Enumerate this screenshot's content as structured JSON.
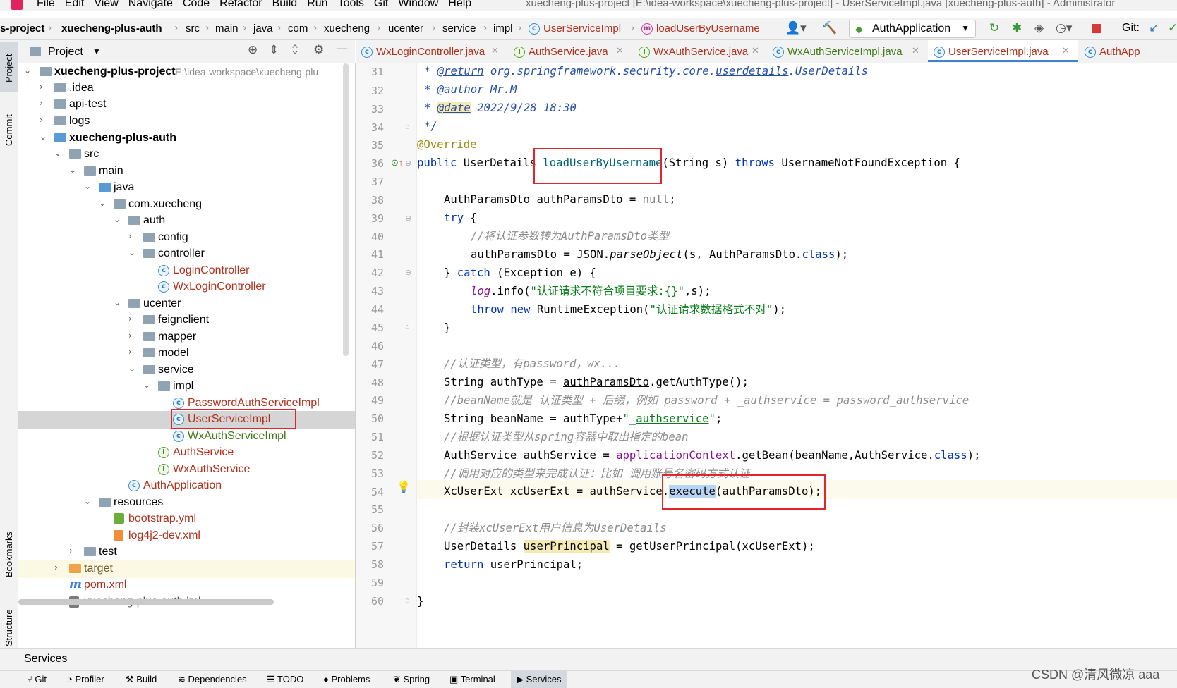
{
  "menu": {
    "items": [
      "File",
      "Edit",
      "View",
      "Navigate",
      "Code",
      "Refactor",
      "Build",
      "Run",
      "Tools",
      "Git",
      "Window",
      "Help"
    ],
    "window_title": "xuecheng-plus-project [E:\\idea-workspace\\xuecheng-plus-project] - UserServiceImpl.java [xuecheng-plus-auth] - Administrator"
  },
  "navbar": {
    "breadcrumbs": [
      "s-project",
      "xuecheng-plus-auth",
      "src",
      "main",
      "java",
      "com",
      "xuecheng",
      "ucenter",
      "service",
      "impl",
      "UserServiceImpl",
      "loadUserByUsername"
    ],
    "run_config": "AuthApplication",
    "git_label": "Git:"
  },
  "leftstrip": {
    "project": "Project",
    "commit": "Commit",
    "bookmarks": "Bookmarks",
    "structure": "Structure"
  },
  "project_panel": {
    "title": "Project",
    "tree": [
      {
        "label": "xuecheng-plus-project",
        "path": "E:\\idea-workspace\\xuecheng-plu",
        "bold": true
      },
      {
        "label": ".idea"
      },
      {
        "label": "api-test"
      },
      {
        "label": "logs"
      },
      {
        "label": "xuecheng-plus-auth",
        "bold": true
      },
      {
        "label": "src"
      },
      {
        "label": "main"
      },
      {
        "label": "java"
      },
      {
        "label": "com.xuecheng"
      },
      {
        "label": "auth"
      },
      {
        "label": "config"
      },
      {
        "label": "controller"
      },
      {
        "label": "LoginController"
      },
      {
        "label": "WxLoginController"
      },
      {
        "label": "ucenter"
      },
      {
        "label": "feignclient"
      },
      {
        "label": "mapper"
      },
      {
        "label": "model"
      },
      {
        "label": "service"
      },
      {
        "label": "impl"
      },
      {
        "label": "PasswordAuthServiceImpl"
      },
      {
        "label": "UserServiceImpl"
      },
      {
        "label": "WxAuthServiceImpl"
      },
      {
        "label": "AuthService"
      },
      {
        "label": "WxAuthService"
      },
      {
        "label": "AuthApplication"
      },
      {
        "label": "resources"
      },
      {
        "label": "bootstrap.yml"
      },
      {
        "label": "log4j2-dev.xml"
      },
      {
        "label": "test"
      },
      {
        "label": "target"
      },
      {
        "label": "pom.xml"
      },
      {
        "label": "xuecheng-plus-auth.iml"
      }
    ]
  },
  "tabs": [
    {
      "label": "WxLoginController.java",
      "icon": "class-icon"
    },
    {
      "label": "AuthService.java",
      "icon": "interface-icon"
    },
    {
      "label": "WxAuthService.java",
      "icon": "interface-icon"
    },
    {
      "label": "WxAuthServiceImpl.java",
      "icon": "class-icon"
    },
    {
      "label": "UserServiceImpl.java",
      "icon": "class-icon",
      "active": true
    },
    {
      "label": "AuthApp",
      "icon": "class-icon"
    }
  ],
  "editor": {
    "line_numbers": [
      "31",
      "32",
      "33",
      "34",
      "35",
      "36",
      "37",
      "38",
      "39",
      "40",
      "41",
      "42",
      "43",
      "44",
      "45",
      "46",
      "47",
      "48",
      "49",
      "50",
      "51",
      "52",
      "53",
      "54",
      "55",
      "56",
      "57",
      "58",
      "59",
      "60"
    ],
    "code": {
      "l31a": "* ",
      "l31b": "@return",
      "l31c": " org.springframework.security.core.",
      "l31d": "userdetails",
      "l31e": ".UserDetails",
      "l32a": "* ",
      "l32b": "@author",
      "l32c": " Mr.M",
      "l33a": "* ",
      "l33b": "@date",
      "l33c": " 2022/9/28 18:30",
      "l34": "*/",
      "l35": "@Override",
      "l36a": "public",
      "l36b": " UserDetails ",
      "l36c": "loadUserByUsername",
      "l36d": "(String s) ",
      "l36e": "throws",
      "l36f": " UsernameNotFoundException {",
      "l38a": "AuthParamsDto ",
      "l38b": "authParamsDto",
      "l38c": " = ",
      "l38d": "null",
      "l38e": ";",
      "l39a": "try",
      "l39b": " {",
      "l40": "//将认证参数转为AuthParamsDto类型",
      "l41a": "authParamsDto",
      "l41b": " = JSON.",
      "l41c": "parseObject",
      "l41d": "(s, AuthParamsDto.",
      "l41e": "class",
      "l41f": ");",
      "l42a": "} ",
      "l42b": "catch",
      "l42c": " (Exception e) {",
      "l43a": "log",
      "l43b": ".info(",
      "l43c": "\"认证请求不符合项目要求:{}\"",
      "l43d": ",s);",
      "l44a": "throw",
      "l44b": " ",
      "l44c": "new",
      "l44d": " RuntimeException(",
      "l44e": "\"认证请求数据格式不对\"",
      "l44f": ");",
      "l45": "}",
      "l47": "//认证类型，有password，wx...",
      "l48a": "String authType = ",
      "l48b": "authParamsDto",
      "l48c": ".getAuthType();",
      "l49a": "//beanName就是 认证类型 + 后缀，例如 password + _",
      "l49b": "authservice",
      "l49c": " = password_",
      "l49d": "authservice",
      "l50a": "String beanName = authType+",
      "l50b": "\"_",
      "l50c": "authservice",
      "l50d": "\"",
      "l50e": ";",
      "l51": "//根据认证类型从spring容器中取出指定的bean",
      "l52a": "AuthService authService = ",
      "l52b": "applicationContext",
      "l52c": ".getBean(beanName,AuthService.",
      "l52d": "class",
      "l52e": ");",
      "l53": "//调用对应的类型来完成认证：比如 调用账号名密码方式认证",
      "l54a": "XcUserExt xcUserExt = authService.",
      "l54b": "execute",
      "l54c": "(",
      "l54d": "authParamsDto",
      "l54e": ");",
      "l56": "//封装xcUserExt用户信息为UserDetails",
      "l57a": "UserDetails ",
      "l57b": "userPrincipal",
      "l57c": " = getUserPrincipal(xcUserExt);",
      "l58a": "return",
      "l58b": " userPrincipal;",
      "l60": "}"
    }
  },
  "services_bar": {
    "label": "Services"
  },
  "bottom_tools": [
    "Git",
    "Profiler",
    "Build",
    "Dependencies",
    "TODO",
    "Problems",
    "Spring",
    "Terminal",
    "Services"
  ],
  "watermark": "CSDN @清风微凉 aaa",
  "colors": {
    "highlight_box": "#e0262b",
    "active_tab": "#4083c9",
    "keyword": "#0033b3",
    "comment": "#8c8c8c",
    "string": "#067d17"
  }
}
